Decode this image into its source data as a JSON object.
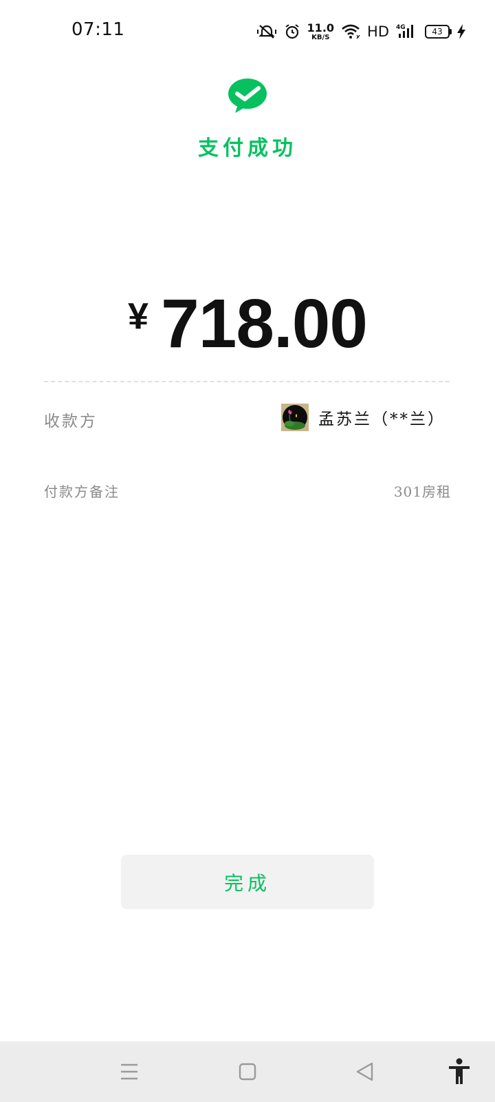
{
  "status_bar": {
    "time": "07:11",
    "net_speed_value": "11.0",
    "net_speed_unit": "KB/S",
    "hd_label": "HD",
    "network_type": "4G",
    "battery_level": "43",
    "icons": [
      "vibrate-mute-icon",
      "alarm-icon",
      "wifi-icon",
      "signal-icon",
      "battery-icon",
      "charging-icon"
    ]
  },
  "header": {
    "logo": "wechat-pay-icon",
    "title": "支付成功",
    "accent_color": "#07c160"
  },
  "payment": {
    "currency": "¥",
    "amount": "718.00"
  },
  "details": {
    "payee_label": "收款方",
    "payee_name": "孟苏兰（**兰）",
    "remark_label": "付款方备注",
    "remark_value": "301房租"
  },
  "actions": {
    "done_label": "完成"
  },
  "nav_bar": {
    "icons": [
      "menu-icon",
      "home-icon",
      "back-icon",
      "accessibility-icon"
    ]
  }
}
